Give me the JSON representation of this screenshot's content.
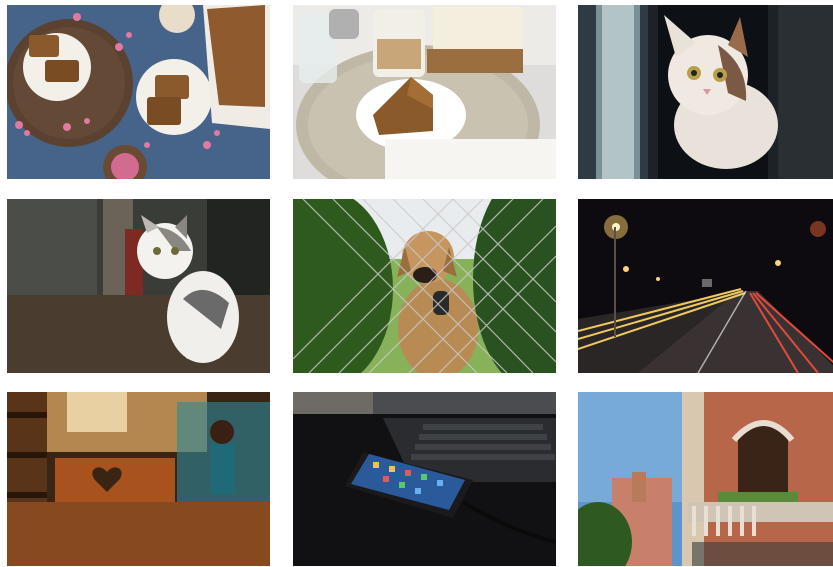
{
  "gallery": {
    "photos": [
      {
        "subject": "cake-slices-flowers",
        "bg": "#3f5b80"
      },
      {
        "subject": "latte-cake-book",
        "bg": "#d9d9d6"
      },
      {
        "subject": "cat-at-window",
        "bg": "#1a1f24"
      },
      {
        "subject": "cat-sitting-floor",
        "bg": "#2c2d2a"
      },
      {
        "subject": "dog-behind-fence",
        "bg": "#3e6a2c"
      },
      {
        "subject": "highway-night-light-trails",
        "bg": "#0e0c10"
      },
      {
        "subject": "cafe-chair-heart",
        "bg": "#4a2a14"
      },
      {
        "subject": "smartphone-on-laptop",
        "bg": "#141416"
      },
      {
        "subject": "venice-buildings",
        "bg": "#5c8fc8"
      }
    ]
  },
  "colors": {
    "background": "#ffffff"
  }
}
